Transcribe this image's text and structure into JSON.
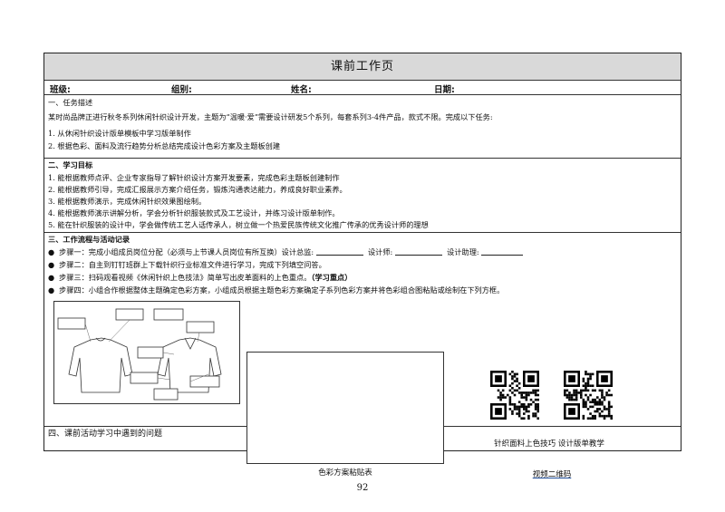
{
  "header": {
    "title": "课前工作页"
  },
  "info": {
    "class": "班级:",
    "group": "组别:",
    "name": "姓名:",
    "date": "日期:"
  },
  "task": {
    "heading": "一、任务描述",
    "desc": "某时尚品牌正进行秋冬系列休闲针织设计开发，主题为“温暖·爱”需要设计研发5个系列，每套系列3-4件产品，款式不限。完成以下任务:",
    "items": [
      "1.  从休闲针织设计版单模板中学习版单制作",
      "2.  根据色彩、面料及流行趋势分析总结完成设计色彩方案及主题板创建"
    ]
  },
  "goals": {
    "heading": "二、学习目标",
    "items": [
      "1.   能根据教师点评、企业专家指导了解针织设计方案开发要素，完成色彩主题板创建制作",
      "2.   能根据教师引导，完成汇报展示方案介绍任务，锻炼沟通表达能力，养成良好职业素养。",
      "3.   能根据教师演示，完成休闲针织效果图绘制。",
      "4.   能根据教师演示讲解分析，学会分析针织服装款式及工艺设计，并练习设计版单制作。",
      "5.   能在针织服装的设计中，学会做传统工艺人话传承人，树立做一个热爱民族传统文化推广传承的优秀设计师的理想"
    ]
  },
  "process": {
    "heading": "三、工作流程与活动记录",
    "step1_a": "步骤一：完成小组成员岗位分配（必须与上节课人员岗位有所互换）设计总监:",
    "step1_b": "设计师:",
    "step1_c": "设计助理:",
    "step2": "步骤二：自主到钉钉班群上下载针织行业标准文件进行学习，完成下列填空问答。",
    "step3_a": "步骤三：扫码观看视频《休闲针织上色技法》简单写出皮革面料的上色重点。",
    "step3_b": "（学习重点）",
    "step4": "步骤四：小组合作根据整体主题确定色彩方案，小组成员根据主题色彩方案确定子系列色彩方案并将色彩组合图粘贴或绘制在下列方框。"
  },
  "panels": {
    "color_caption": "色彩方案粘贴表",
    "qr_caption": "针织面料上色技巧    设计版单教学",
    "video_caption": "视频二维码"
  },
  "problems": {
    "heading": "四、课前活动学习中遇到的问题"
  },
  "page": {
    "number": "92"
  }
}
